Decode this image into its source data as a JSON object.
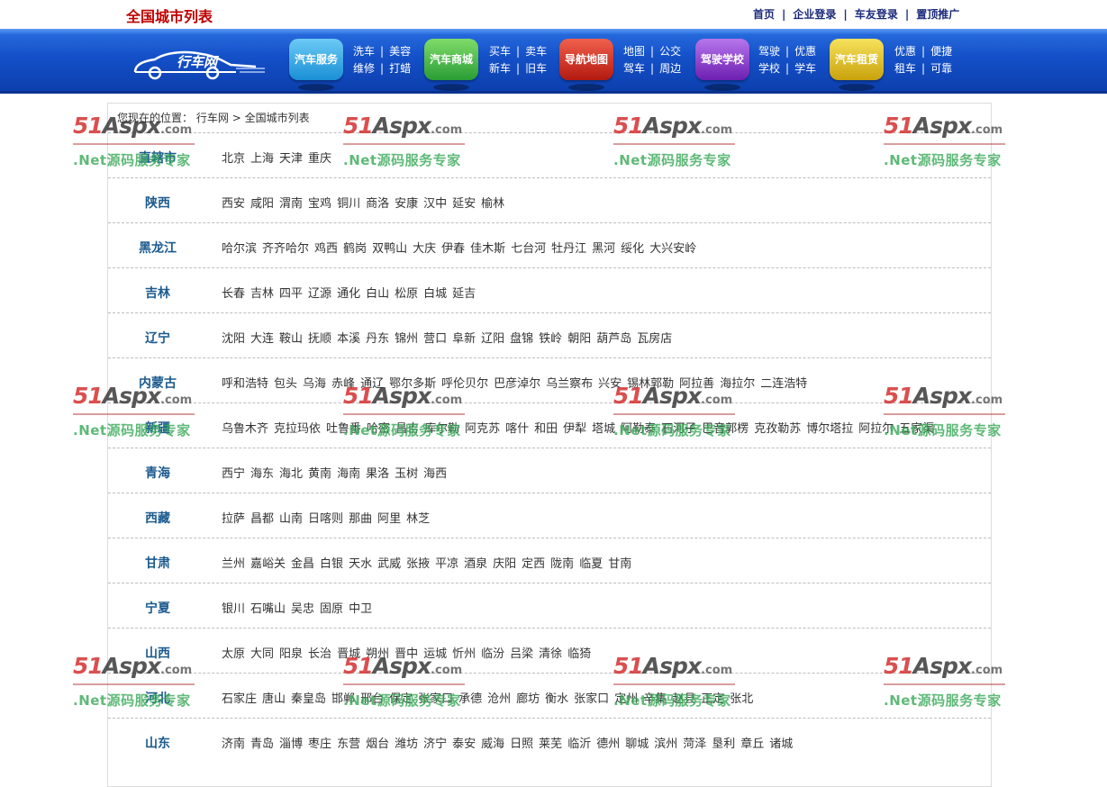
{
  "header": {
    "title": "全国城市列表",
    "links": [
      "首页",
      "企业登录",
      "车友登录",
      "置顶推广"
    ]
  },
  "nav": {
    "logo_text": "行车网",
    "buttons": [
      {
        "label": "汽车服务",
        "color": "#2aa7e8",
        "sub": [
          [
            "洗车",
            "美容"
          ],
          [
            "维修",
            "打蜡"
          ]
        ]
      },
      {
        "label": "汽车商城",
        "color": "#39b84a",
        "sub": [
          [
            "买车",
            "卖车"
          ],
          [
            "新车",
            "旧车"
          ]
        ]
      },
      {
        "label": "导航地图",
        "color": "#d42d1f",
        "sub": [
          [
            "地图",
            "公交"
          ],
          [
            "驾车",
            "周边"
          ]
        ]
      },
      {
        "label": "驾驶学校",
        "color": "#8a36c8",
        "sub": [
          [
            "驾驶",
            "优惠"
          ],
          [
            "学校",
            "学车"
          ]
        ]
      },
      {
        "label": "汽车租赁",
        "color": "#e0c21c",
        "sub": [
          [
            "优惠",
            "便捷"
          ],
          [
            "租车",
            "可靠"
          ]
        ]
      }
    ]
  },
  "breadcrumb": {
    "prefix": "您现在的位置：",
    "home": "行车网",
    "sep": ">",
    "current": "全国城市列表"
  },
  "provinces": [
    {
      "name": "直辖市",
      "cities": [
        "北京",
        "上海",
        "天津",
        "重庆"
      ]
    },
    {
      "name": "陕西",
      "cities": [
        "西安",
        "咸阳",
        "渭南",
        "宝鸡",
        "铜川",
        "商洛",
        "安康",
        "汉中",
        "延安",
        "榆林"
      ]
    },
    {
      "name": "黑龙江",
      "cities": [
        "哈尔滨",
        "齐齐哈尔",
        "鸡西",
        "鹤岗",
        "双鸭山",
        "大庆",
        "伊春",
        "佳木斯",
        "七台河",
        "牡丹江",
        "黑河",
        "绥化",
        "大兴安岭"
      ]
    },
    {
      "name": "吉林",
      "cities": [
        "长春",
        "吉林",
        "四平",
        "辽源",
        "通化",
        "白山",
        "松原",
        "白城",
        "延吉"
      ]
    },
    {
      "name": "辽宁",
      "cities": [
        "沈阳",
        "大连",
        "鞍山",
        "抚顺",
        "本溪",
        "丹东",
        "锦州",
        "营口",
        "阜新",
        "辽阳",
        "盘锦",
        "铁岭",
        "朝阳",
        "葫芦岛",
        "瓦房店"
      ]
    },
    {
      "name": "内蒙古",
      "cities": [
        "呼和浩特",
        "包头",
        "乌海",
        "赤峰",
        "通辽",
        "鄂尔多斯",
        "呼伦贝尔",
        "巴彦淖尔",
        "乌兰察布",
        "兴安",
        "锡林郭勒",
        "阿拉善",
        "海拉尔",
        "二连浩特"
      ]
    },
    {
      "name": "新疆",
      "cities": [
        "乌鲁木齐",
        "克拉玛依",
        "吐鲁番",
        "哈密",
        "昌吉",
        "库尔勒",
        "阿克苏",
        "喀什",
        "和田",
        "伊犁",
        "塔城",
        "阿勒泰",
        "石河子",
        "巴音郭楞",
        "克孜勒苏",
        "博尔塔拉",
        "阿拉尔",
        "五家渠"
      ]
    },
    {
      "name": "青海",
      "cities": [
        "西宁",
        "海东",
        "海北",
        "黄南",
        "海南",
        "果洛",
        "玉树",
        "海西"
      ]
    },
    {
      "name": "西藏",
      "cities": [
        "拉萨",
        "昌都",
        "山南",
        "日喀则",
        "那曲",
        "阿里",
        "林芝"
      ]
    },
    {
      "name": "甘肃",
      "cities": [
        "兰州",
        "嘉峪关",
        "金昌",
        "白银",
        "天水",
        "武威",
        "张掖",
        "平凉",
        "酒泉",
        "庆阳",
        "定西",
        "陇南",
        "临夏",
        "甘南"
      ]
    },
    {
      "name": "宁夏",
      "cities": [
        "银川",
        "石嘴山",
        "吴忠",
        "固原",
        "中卫"
      ]
    },
    {
      "name": "山西",
      "cities": [
        "太原",
        "大同",
        "阳泉",
        "长治",
        "晋城",
        "朔州",
        "晋中",
        "运城",
        "忻州",
        "临汾",
        "吕梁",
        "清徐",
        "临猗"
      ]
    },
    {
      "name": "河北",
      "cities": [
        "石家庄",
        "唐山",
        "秦皇岛",
        "邯郸",
        "邢台",
        "保定",
        "张家口",
        "承德",
        "沧州",
        "廊坊",
        "衡水",
        "张家口",
        "定州",
        "辛集",
        "赵县",
        "正定",
        "张北"
      ]
    },
    {
      "name": "山东",
      "cities": [
        "济南",
        "青岛",
        "淄博",
        "枣庄",
        "东营",
        "烟台",
        "潍坊",
        "济宁",
        "泰安",
        "威海",
        "日照",
        "莱芜",
        "临沂",
        "德州",
        "聊城",
        "滨州",
        "菏泽",
        "垦利",
        "章丘",
        "诸城"
      ]
    }
  ],
  "watermark": {
    "brand": "51",
    "brand2": "Aspx",
    "domain": ".com",
    "tagline": ".Net源码服务专家"
  }
}
